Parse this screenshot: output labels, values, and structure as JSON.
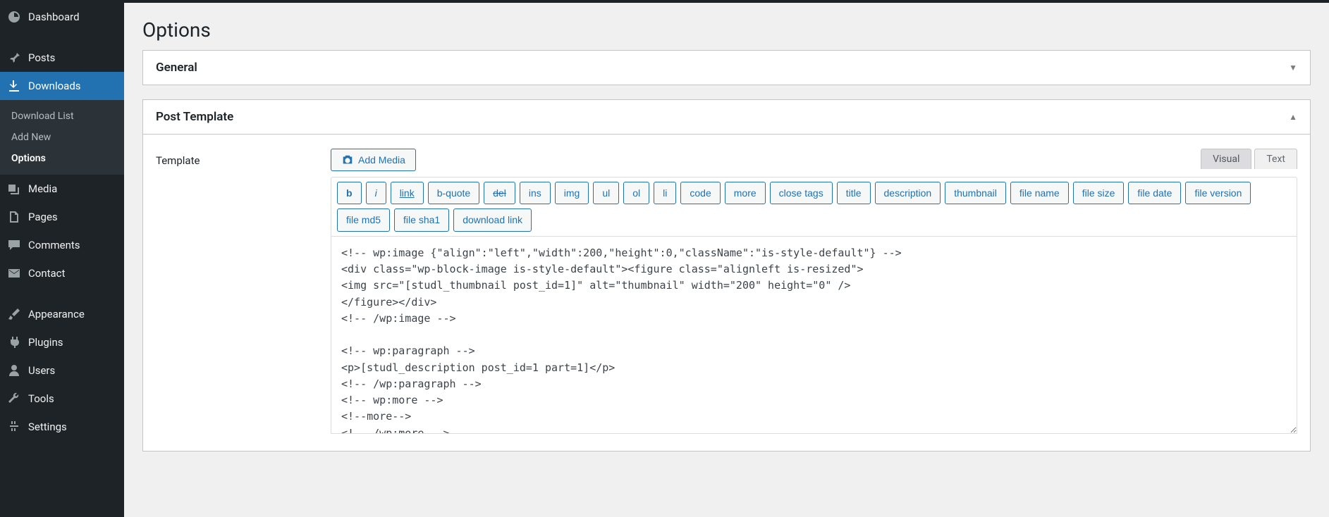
{
  "sidebar": {
    "items": [
      {
        "label": "Dashboard"
      },
      {
        "label": "Posts"
      },
      {
        "label": "Downloads"
      },
      {
        "label": "Media"
      },
      {
        "label": "Pages"
      },
      {
        "label": "Comments"
      },
      {
        "label": "Contact"
      },
      {
        "label": "Appearance"
      },
      {
        "label": "Plugins"
      },
      {
        "label": "Users"
      },
      {
        "label": "Tools"
      },
      {
        "label": "Settings"
      }
    ],
    "submenu": [
      {
        "label": "Download List"
      },
      {
        "label": "Add New"
      },
      {
        "label": "Options"
      }
    ]
  },
  "page": {
    "title": "Options"
  },
  "panels": {
    "general": {
      "title": "General"
    },
    "template": {
      "title": "Post Template"
    }
  },
  "field": {
    "label": "Template"
  },
  "editor": {
    "add_media": "Add Media",
    "tabs": {
      "visual": "Visual",
      "text": "Text"
    },
    "quicktags": [
      "b",
      "i",
      "link",
      "b-quote",
      "del",
      "ins",
      "img",
      "ul",
      "ol",
      "li",
      "code",
      "more",
      "close tags",
      "title",
      "description",
      "thumbnail",
      "file name",
      "file size",
      "file date",
      "file version",
      "file md5",
      "file sha1",
      "download link"
    ],
    "content": "<!-- wp:image {\"align\":\"left\",\"width\":200,\"height\":0,\"className\":\"is-style-default\"} -->\n<div class=\"wp-block-image is-style-default\"><figure class=\"alignleft is-resized\">\n<img src=\"[studl_thumbnail post_id=1]\" alt=\"thumbnail\" width=\"200\" height=\"0\" />\n</figure></div>\n<!-- /wp:image -->\n\n<!-- wp:paragraph -->\n<p>[studl_description post_id=1 part=1]</p>\n<!-- /wp:paragraph -->\n<!-- wp:more -->\n<!--more-->\n<!-- /wp:more -->\n"
  }
}
